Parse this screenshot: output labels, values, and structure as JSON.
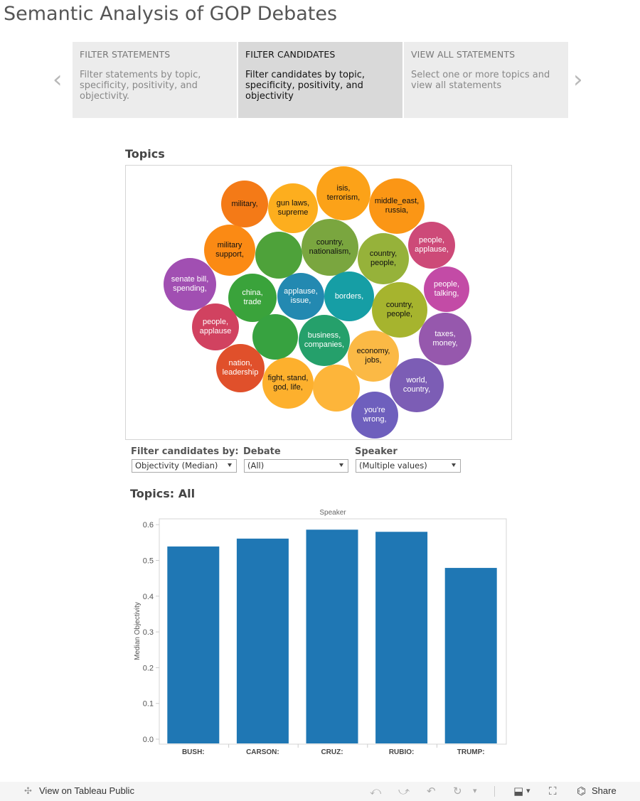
{
  "page": {
    "title": "Semantic Analysis of GOP Debates"
  },
  "story": {
    "prev_label": "‹",
    "next_label": "›",
    "points": [
      {
        "title": "FILTER STATEMENTS",
        "description": "Filter statements by topic, specificity, positivity, and objectivity.",
        "active": false
      },
      {
        "title": "FILTER CANDIDATES",
        "description": "Filter candidates by topic, specificity, positivity, and objectivity",
        "active": true
      },
      {
        "title": "VIEW ALL STATEMENTS",
        "description": "Select one or more topics and view all statements",
        "active": false
      }
    ]
  },
  "topics": {
    "title": "Topics",
    "bubbles": [
      {
        "label": "military,",
        "color": "#f47a17",
        "text": "#111"
      },
      {
        "label": "gun laws, supreme",
        "color": "#fdae1e",
        "text": "#111"
      },
      {
        "label": "isis, terrorism,",
        "color": "#fca218",
        "text": "#111"
      },
      {
        "label": "middle_east, russia,",
        "color": "#fb9615",
        "text": "#111"
      },
      {
        "label": "military support,",
        "color": "#fb8a14",
        "text": "#111"
      },
      {
        "label": "",
        "color": "#4ea23a",
        "text": "#fff"
      },
      {
        "label": "country, nationalism,",
        "color": "#7aa63f",
        "text": "#111"
      },
      {
        "label": "country, people,",
        "color": "#96b23a",
        "text": "#111"
      },
      {
        "label": "people, applause,",
        "color": "#cd4a78",
        "text": "#fff"
      },
      {
        "label": "senate bill, spending,",
        "color": "#a14fb2",
        "text": "#fff"
      },
      {
        "label": "china, trade",
        "color": "#3aa33b",
        "text": "#fff"
      },
      {
        "label": "applause, issue,",
        "color": "#2389b1",
        "text": "#fff"
      },
      {
        "label": "borders,",
        "color": "#169ea5",
        "text": "#fff"
      },
      {
        "label": "people, talking,",
        "color": "#c34ba6",
        "text": "#fff"
      },
      {
        "label": "country, people,",
        "color": "#a6b42e",
        "text": "#111"
      },
      {
        "label": "people, applause",
        "color": "#d14260",
        "text": "#fff"
      },
      {
        "label": "",
        "color": "#37a240",
        "text": "#fff"
      },
      {
        "label": "business, companies,",
        "color": "#25a06b",
        "text": "#fff"
      },
      {
        "label": "taxes, money,",
        "color": "#9658ad",
        "text": "#fff"
      },
      {
        "label": "economy, jobs,",
        "color": "#fbb945",
        "text": "#111"
      },
      {
        "label": "nation, leadership",
        "color": "#e0502b",
        "text": "#fff"
      },
      {
        "label": "fight, stand, god, life,",
        "color": "#fdb02d",
        "text": "#111"
      },
      {
        "label": "",
        "color": "#fdb53a",
        "text": "#111"
      },
      {
        "label": "world, country,",
        "color": "#7c5db5",
        "text": "#fff"
      },
      {
        "label": "you're wrong,",
        "color": "#6e5fbd",
        "text": "#fff"
      }
    ]
  },
  "filters": {
    "filter_by": {
      "label": "Filter candidates by:",
      "value": "Objectivity (Median)"
    },
    "debate": {
      "label": "Debate",
      "value": "(All)"
    },
    "speaker": {
      "label": "Speaker",
      "value": "(Multiple values)"
    }
  },
  "chart_title": "Topics: All",
  "chart_data": {
    "type": "bar",
    "title": "Topics: All",
    "column_header": "Speaker",
    "xlabel": "Speaker",
    "ylabel": "Median Objectivity",
    "categories": [
      "BUSH:",
      "CARSON:",
      "CRUZ:",
      "RUBIO:",
      "TRUMP:"
    ],
    "values": [
      0.539,
      0.561,
      0.586,
      0.58,
      0.479
    ],
    "ylim": [
      0,
      0.62
    ],
    "yticks": [
      0.0,
      0.1,
      0.2,
      0.3,
      0.4,
      0.5,
      0.6
    ],
    "ytick_labels": [
      "0.0",
      "0.1",
      "0.2",
      "0.3",
      "0.4",
      "0.5",
      "0.6"
    ],
    "bar_color": "#1f77b4",
    "grid": false
  },
  "toolbar": {
    "view_on": "View on Tableau Public",
    "share": "Share",
    "undo": "⤺",
    "redo": "⤻",
    "revert": "↶",
    "refresh": "↻",
    "menu_caret": "▾",
    "download": "⬓",
    "fullscreen": "⛶",
    "share_icon": "⌬",
    "tableau_icon": "✣"
  }
}
